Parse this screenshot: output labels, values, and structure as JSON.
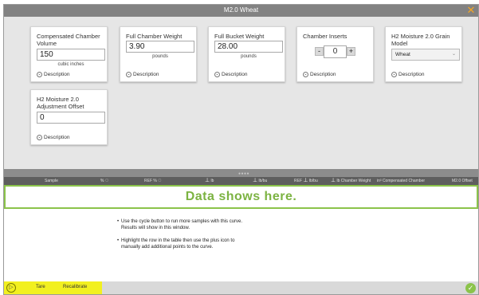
{
  "window": {
    "title": "M2.0 Wheat",
    "close_glyph": "✕"
  },
  "cards": {
    "compensated": {
      "label": "Compensated Chamber Volume",
      "value": "150",
      "unit": "cubic inches",
      "desc": "Description"
    },
    "full_chamber": {
      "label": "Full Chamber Weight",
      "value": "3.90",
      "unit": "pounds",
      "desc": "Description"
    },
    "full_bucket": {
      "label": "Full Bucket Weight",
      "value": "28.00",
      "unit": "pounds",
      "desc": "Description"
    },
    "inserts": {
      "label": "Chamber Inserts",
      "value": "0",
      "minus": "-",
      "plus": "+",
      "desc": "Description"
    },
    "grain_model": {
      "label": "H2 Moisture 2.0 Grain Model",
      "value": "Wheat",
      "desc": "Description"
    },
    "adjust_offset": {
      "label": "H2 Moisture 2.0 Adjustment Offset",
      "value": "0",
      "desc": "Description"
    }
  },
  "table_header": {
    "sample": "Sample",
    "pct": "%",
    "ref_pct": "REF %",
    "lb": "lb",
    "lbbu": "lb/bu",
    "ref_lbbu": "REF",
    "ref_lbbu2": "lb/bu",
    "chamber_weight": "lb Chamber Weight",
    "compensated": "in³ Compensated Chamber",
    "offset": "M2.0 Offset"
  },
  "banner": {
    "text": "Data shows here."
  },
  "instructions": [
    {
      "line1": "Use the cycle button to run more samples with this curve.",
      "line2": "Results will show in this window."
    },
    {
      "line1": "Highlight the row in the table then use the plus icon to",
      "line2": "manually add additional points to the curve."
    }
  ],
  "bottom": {
    "tare": "Tare",
    "recalibrate": "Recalibrate"
  },
  "colors": {
    "accent_green": "#8bc34a",
    "bottom_yellow": "#f2f020",
    "close_orange": "#f5a623"
  },
  "icons": {
    "close": "close-icon",
    "cycle": "cycle-icon",
    "confirm": "check-icon",
    "description": "chevron-down-icon"
  }
}
